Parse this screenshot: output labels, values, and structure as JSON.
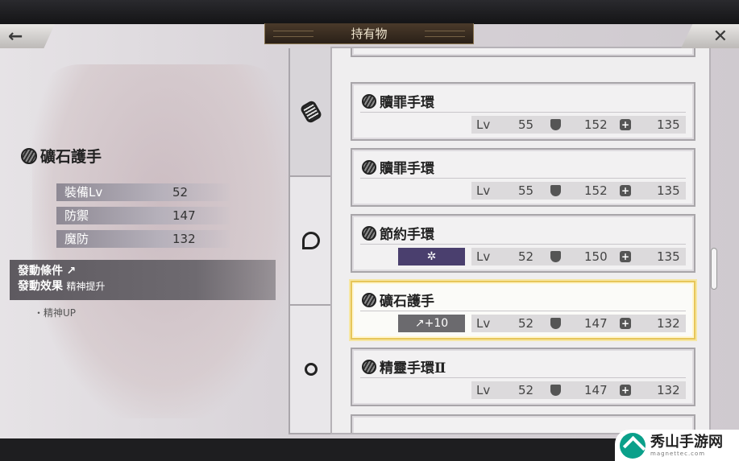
{
  "header": {
    "title": "持有物",
    "back_icon": "←",
    "close_icon": "✕"
  },
  "selected_item": {
    "name": "礦石護手",
    "stats": [
      {
        "label": "裝備Lv",
        "value": "52"
      },
      {
        "label": "防禦",
        "value": "147"
      },
      {
        "label": "魔防",
        "value": "132"
      }
    ],
    "skill": {
      "condition_label": "發動條件",
      "condition_value": "↗",
      "effect_label": "發動效果",
      "effect_value": "精神提升",
      "note": "・精神UP"
    }
  },
  "tabs": [
    {
      "name": "bracelet-tab",
      "icon": "bracelet"
    },
    {
      "name": "earring-tab",
      "icon": "earring"
    },
    {
      "name": "ring-tab",
      "icon": "ring"
    }
  ],
  "items": [
    {
      "name": "贖罪手環",
      "badge": "",
      "lv_label": "Lv",
      "lv": "55",
      "def": "152",
      "mdef": "135"
    },
    {
      "name": "贖罪手環",
      "badge": "",
      "lv_label": "Lv",
      "lv": "55",
      "def": "152",
      "mdef": "135"
    },
    {
      "name": "節約手環",
      "badge": "✲",
      "lv_label": "Lv",
      "lv": "52",
      "def": "150",
      "mdef": "135"
    },
    {
      "name": "礦石護手",
      "badge": "↗+10",
      "lv_label": "Lv",
      "lv": "52",
      "def": "147",
      "mdef": "132"
    },
    {
      "name": "精靈手環Ⅱ",
      "badge": "",
      "lv_label": "Lv",
      "lv": "52",
      "def": "147",
      "mdef": "132"
    }
  ],
  "watermark": {
    "text": "秀山手游网",
    "sub": "magnettec.com"
  },
  "colors": {
    "selected_border": "#e7c65a",
    "star_badge": "#4a3f6e",
    "arrow_badge": "#6b6a6e"
  }
}
